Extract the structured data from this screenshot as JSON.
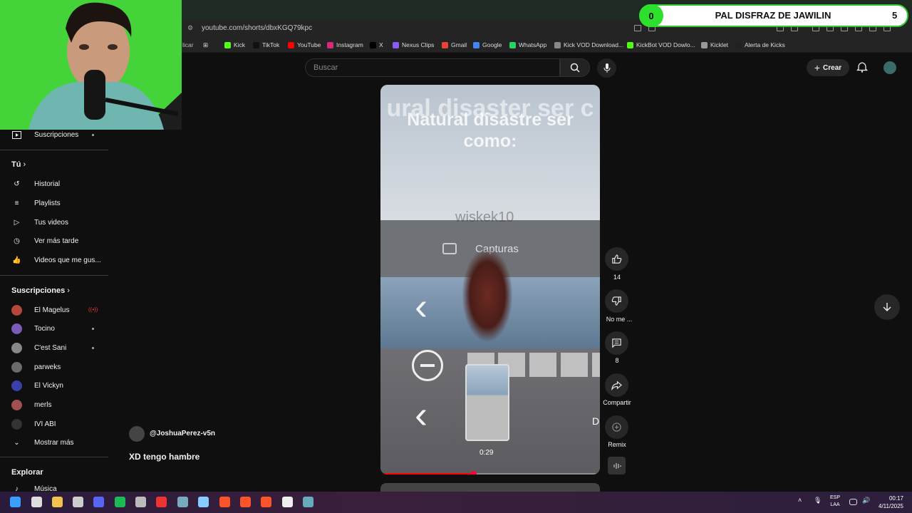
{
  "browser": {
    "url": "youtube.com/shorts/dbxKGQ79kpc",
    "bookmarks": [
      {
        "label": "Kick",
        "color": "#53fc18"
      },
      {
        "label": "TikTok",
        "color": "#111111"
      },
      {
        "label": "YouTube",
        "color": "#ff0000"
      },
      {
        "label": "Instagram",
        "color": "#d62976"
      },
      {
        "label": "X",
        "color": "#000000"
      },
      {
        "label": "Nexus Clips",
        "color": "#8a5cf6"
      },
      {
        "label": "Gmail",
        "color": "#ea4335"
      },
      {
        "label": "Google",
        "color": "#4285f4"
      },
      {
        "label": "WhatsApp",
        "color": "#25d366"
      },
      {
        "label": "Kick VOD Download...",
        "color": "#888888"
      },
      {
        "label": "KickBot VOD Dowlo...",
        "color": "#53fc18"
      },
      {
        "label": "Kicklet",
        "color": "#999999"
      },
      {
        "label": "Alerta de Kicks",
        "color": "#222222"
      }
    ],
    "bookmark_partial": "licar"
  },
  "overlay": {
    "left_count": "0",
    "title": "PAL DISFRAZ DE JAWILIN",
    "right_count": "5"
  },
  "header": {
    "search_placeholder": "Buscar",
    "create_label": "Crear"
  },
  "sidebar": {
    "top_item": "Suscripciones",
    "you_heading": "Tú",
    "you_items": [
      "Historial",
      "Playlists",
      "Tus videos",
      "Ver más tarde",
      "Videos que me gus..."
    ],
    "subs_heading": "Suscripciones",
    "channels": [
      {
        "name": "El Magelus",
        "color": "#b5473a",
        "status": "live"
      },
      {
        "name": "Tocino",
        "color": "#7a5cb8",
        "status": "dot"
      },
      {
        "name": "C'est Sani",
        "color": "#888888",
        "status": "dot"
      },
      {
        "name": "parweks",
        "color": "#6b6b6b",
        "status": ""
      },
      {
        "name": "El Vickyn",
        "color": "#3b3fa8",
        "status": ""
      },
      {
        "name": "merls",
        "color": "#a05050",
        "status": ""
      },
      {
        "name": "IVI ABI",
        "color": "#333333",
        "status": ""
      }
    ],
    "show_more": "Mostrar más",
    "explore_heading": "Explorar",
    "explore_items": [
      "Música"
    ]
  },
  "short": {
    "overlay_text_top": "ural disaster ser c",
    "overlay_text_main": "Natural disastre ser como:",
    "overlay_user": "wiskek10",
    "capturas_label": "Capturas",
    "time": "0:29",
    "side_letter": "D",
    "progress": 0.42
  },
  "actions": {
    "likes": "14",
    "dislike_label": "No me ...",
    "comments": "8",
    "share_label": "Compartir",
    "remix_label": "Remix"
  },
  "channel": {
    "handle": "@JoshuaPerez-v5n",
    "title": "XD tengo hambre"
  },
  "taskbar": {
    "lang_top": "ESP",
    "lang_bottom": "LAA",
    "time": "00:17",
    "date": "4/11/2025"
  }
}
